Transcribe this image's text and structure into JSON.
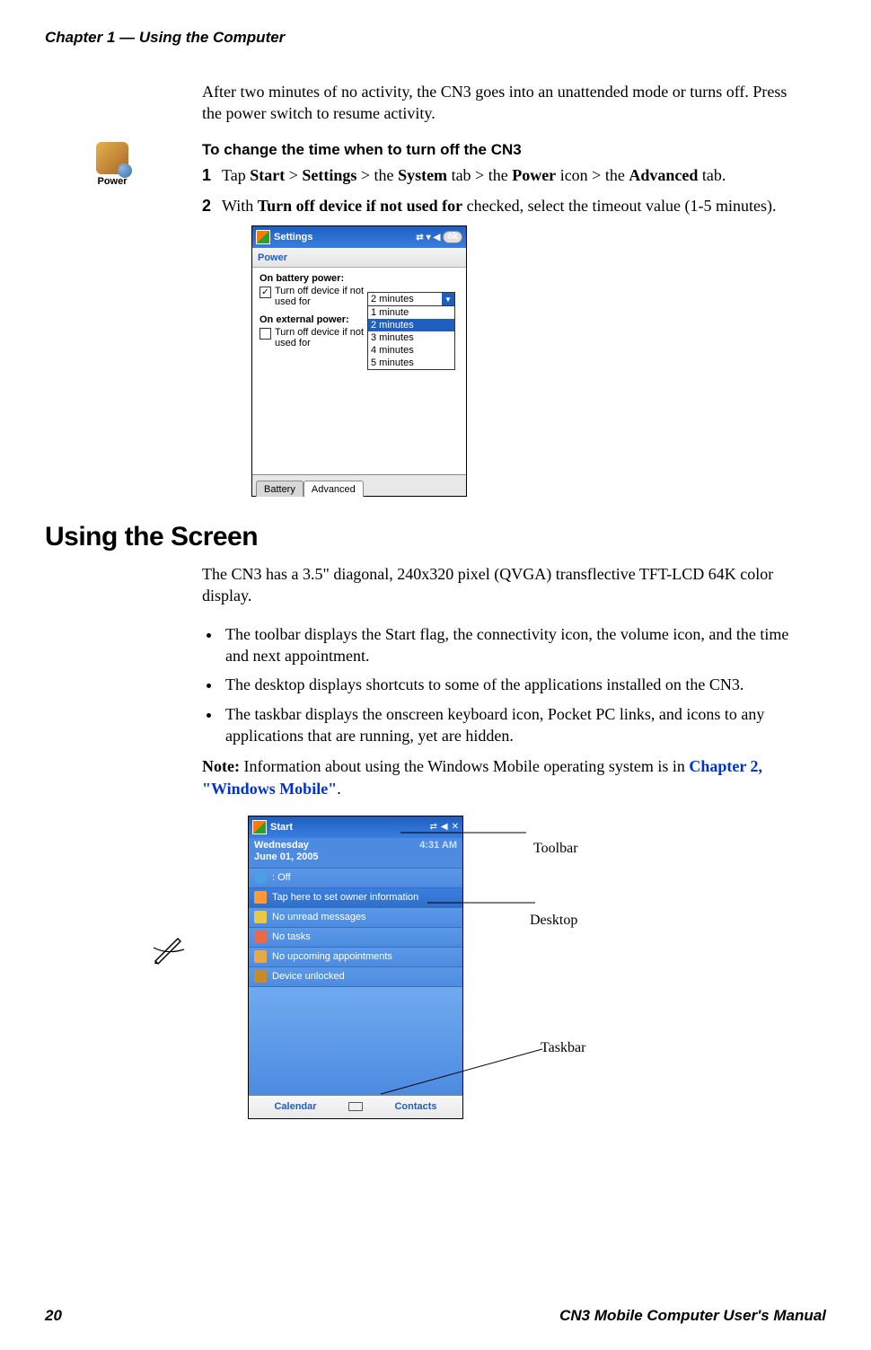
{
  "header": {
    "chapter": "Chapter 1 — Using the Computer"
  },
  "intro": "After two minutes of no activity, the CN3 goes into an unattended mode or turns off. Press the power switch to resume activity.",
  "power_icon_label": "Power",
  "procedure": {
    "title": "To change the time when to turn off the CN3",
    "step1": {
      "num": "1",
      "pre": "Tap ",
      "b1": "Start",
      "s1": " > ",
      "b2": "Settings",
      "s2": " > the ",
      "b3": "System",
      "s3": " tab > the ",
      "b4": "Power",
      "s4": " icon > the ",
      "b5": "Advanced",
      "s5": " tab."
    },
    "step2": {
      "num": "2",
      "pre": "With ",
      "b1": "Turn off device if not used for",
      "post": " checked, select the timeout value (1-5 minutes)."
    }
  },
  "shot1": {
    "titlebar": "Settings",
    "ok": "ok",
    "subtitle": "Power",
    "battery_label": "On battery power:",
    "battery_check_text": "Turn off device if not used for",
    "battery_checked": true,
    "external_label": "On external power:",
    "external_check_text": "Turn off device if not used for",
    "external_checked": false,
    "combo_value": "2 minutes",
    "options": [
      "1 minute",
      "2 minutes",
      "3 minutes",
      "4 minutes",
      "5 minutes"
    ],
    "selected_index": 1,
    "tabs": [
      "Battery",
      "Advanced"
    ],
    "active_tab": 1
  },
  "section_heading": "Using the Screen",
  "section_para": "The CN3 has a 3.5\" diagonal, 240x320 pixel (QVGA) transflective TFT-LCD 64K color display.",
  "bullets": [
    "The toolbar displays the Start flag, the connectivity icon, the volume icon, and the time and next appointment.",
    "The desktop displays shortcuts to some of the applications installed on the CN3.",
    "The taskbar displays the onscreen keyboard icon, Pocket PC links, and icons to any applications that are running, yet are hidden."
  ],
  "note": {
    "label": "Note:",
    "text": " Information about using the Windows Mobile operating system is in ",
    "link": "Chapter 2, \"Windows Mobile\"",
    "post": "."
  },
  "shot2": {
    "title": "Start",
    "date": {
      "dow": "Wednesday",
      "date": "June 01, 2005"
    },
    "time": "4:31 AM",
    "rows": {
      "bt": ": Off",
      "owner": "Tap here to set owner information",
      "msgs": "No unread messages",
      "tasks": "No tasks",
      "appt": "No upcoming appointments",
      "lock": "Device unlocked"
    },
    "task_left": "Calendar",
    "task_right": "Contacts"
  },
  "callouts": {
    "toolbar": "Toolbar",
    "desktop": "Desktop",
    "taskbar": "Taskbar"
  },
  "footer": {
    "page": "20",
    "title": "CN3 Mobile Computer User's Manual"
  }
}
